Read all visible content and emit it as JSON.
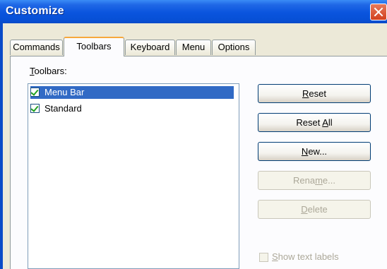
{
  "window": {
    "title": "Customize"
  },
  "tabs": [
    {
      "label": "Commands",
      "active": false
    },
    {
      "label": "Toolbars",
      "active": true
    },
    {
      "label": "Keyboard",
      "active": false
    },
    {
      "label": "Menu",
      "active": false
    },
    {
      "label": "Options",
      "active": false
    }
  ],
  "toolbars_label": {
    "pre": "",
    "accel": "T",
    "post": "oolbars:"
  },
  "toolbar_list": [
    {
      "label": "Menu Bar",
      "checked": true,
      "selected": true
    },
    {
      "label": "Standard",
      "checked": true,
      "selected": false
    }
  ],
  "buttons": {
    "reset": {
      "pre": "",
      "accel": "R",
      "post": "eset",
      "enabled": true
    },
    "reset_all": {
      "pre": "Reset ",
      "accel": "A",
      "post": "ll",
      "enabled": true
    },
    "new": {
      "pre": "",
      "accel": "N",
      "post": "ew...",
      "enabled": true
    },
    "rename": {
      "pre": "Rena",
      "accel": "m",
      "post": "e...",
      "enabled": false
    },
    "delete": {
      "pre": "",
      "accel": "D",
      "post": "elete",
      "enabled": false
    }
  },
  "show_text_labels": {
    "pre": "",
    "accel": "S",
    "post": "how text labels",
    "checked": false,
    "enabled": false
  },
  "colors": {
    "title_bar": "#0a54de",
    "selection": "#316ac5",
    "dialog_bg": "#ece9d8"
  }
}
